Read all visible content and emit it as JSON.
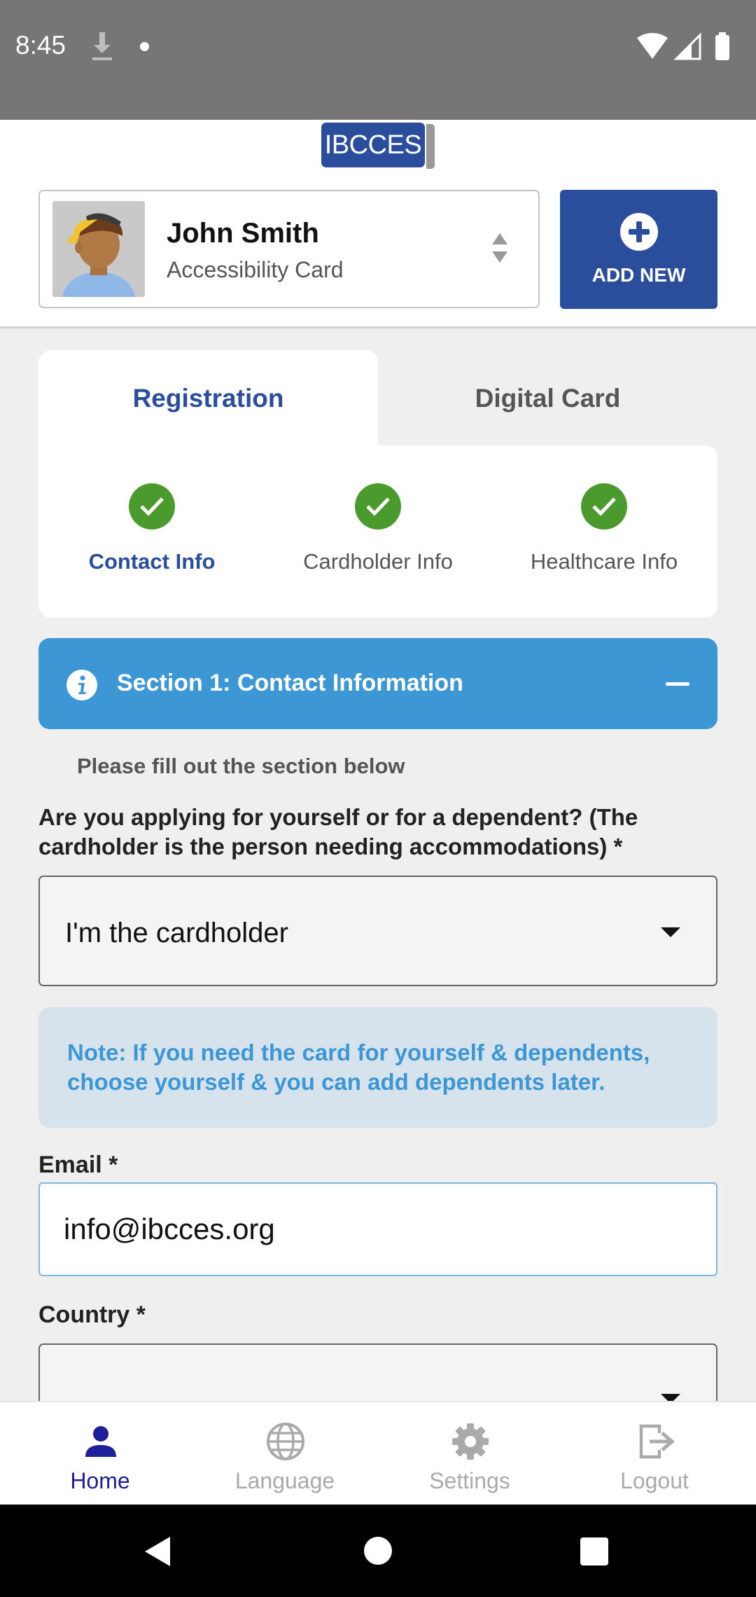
{
  "status_bar": {
    "time": "8:45"
  },
  "header": {
    "logo_text": "IBCCES",
    "profile": {
      "name": "John Smith",
      "subtitle": "Accessibility Card"
    },
    "add_button_label": "ADD NEW"
  },
  "tabs": [
    {
      "label": "Registration",
      "active": true
    },
    {
      "label": "Digital Card",
      "active": false
    }
  ],
  "steps": [
    {
      "label": "Contact Info",
      "complete": true,
      "active": true
    },
    {
      "label": "Cardholder Info",
      "complete": true,
      "active": false
    },
    {
      "label": "Healthcare Info",
      "complete": true,
      "active": false
    }
  ],
  "section": {
    "title": "Section 1: Contact Information",
    "instructions": "Please fill out the section below"
  },
  "form": {
    "question": "Are you applying for yourself or for a dependent? (The cardholder is the person needing accommodations) *",
    "applicant_value": "I'm the cardholder",
    "note": "Note: If you need the card for yourself & dependents, choose yourself & you can add dependents later.",
    "email_label": "Email *",
    "email_value": "info@ibcces.org",
    "country_label": "Country *",
    "country_value": ""
  },
  "bottom_nav": [
    {
      "label": "Home",
      "icon": "person-icon",
      "active": true
    },
    {
      "label": "Language",
      "icon": "globe-icon",
      "active": false
    },
    {
      "label": "Settings",
      "icon": "gear-icon",
      "active": false
    },
    {
      "label": "Logout",
      "icon": "logout-icon",
      "active": false
    }
  ],
  "colors": {
    "brand": "#2a4e9c",
    "section_header": "#3d97d5",
    "success": "#4a9a2d",
    "note_bg": "#d6e3ed",
    "nav_active": "#1f1f9a"
  }
}
